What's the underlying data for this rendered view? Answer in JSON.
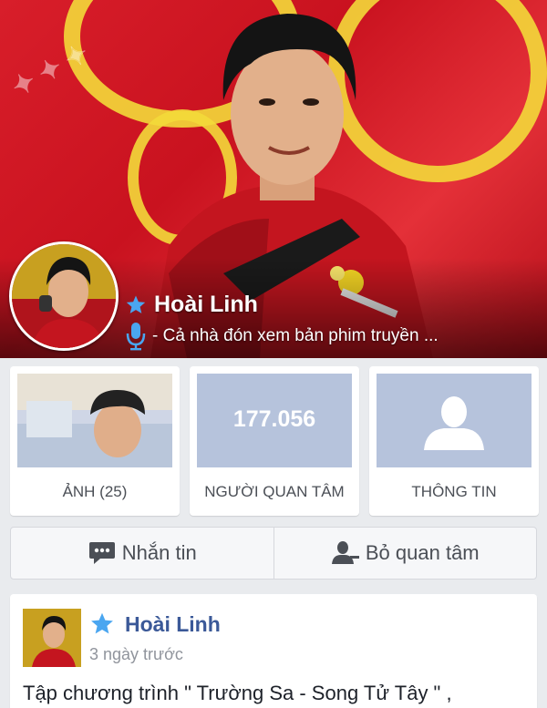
{
  "profile": {
    "name": "Hoài Linh",
    "status": "- Cả nhà đón xem bản phim truyền ..."
  },
  "tiles": [
    {
      "label": "ẢNH (25)"
    },
    {
      "label": "NGƯỜI QUAN TÂM",
      "count": "177.056"
    },
    {
      "label": "THÔNG TIN"
    }
  ],
  "actions": {
    "message_label": "Nhắn tin",
    "unfollow_label": "Bỏ quan tâm"
  },
  "post": {
    "author": "Hoài Linh",
    "time": "3 ngày trước",
    "text": "Tập chương trình \" Trường Sa - Song Tử Tây \" ,"
  },
  "colors": {
    "accent": "#3b5998",
    "star": "#4aa6f0",
    "tile_placeholder": "#b6c3dc",
    "background": "#e9ebee"
  },
  "icons": [
    "star-icon",
    "microphone-icon",
    "chat-icon",
    "person-minus-icon",
    "silhouette-icon"
  ]
}
